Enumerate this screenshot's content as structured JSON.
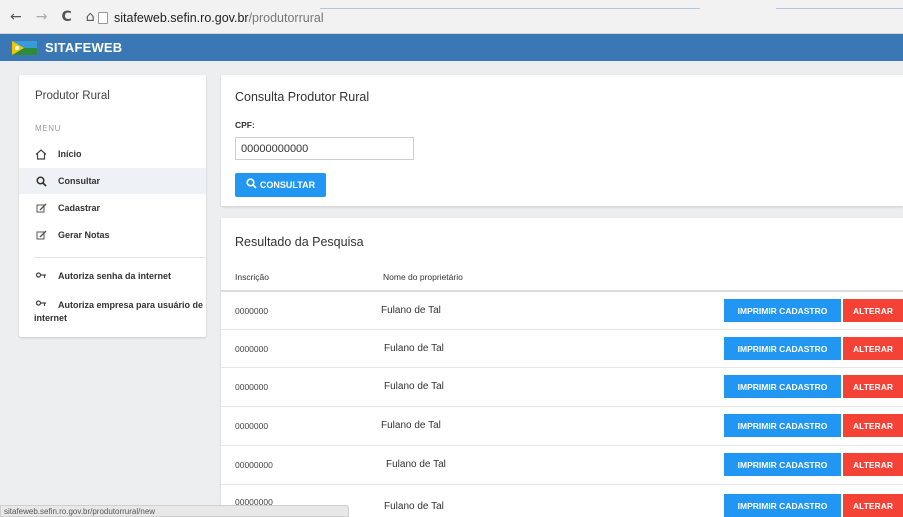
{
  "browser": {
    "url_host": "sitafeweb.sefin.ro.gov.br",
    "url_path": "/produtorrural",
    "status_url": "sitafeweb.sefin.ro.gov.br/produtorrural/new"
  },
  "app": {
    "title": "SITAFEWEB",
    "header_color": "#3a78b5"
  },
  "sidebar": {
    "title": "Produtor Rural",
    "menu_label": "MENU",
    "items": [
      {
        "label": "Início",
        "icon": "home-icon"
      },
      {
        "label": "Consultar",
        "icon": "search-icon",
        "active": true
      },
      {
        "label": "Cadastrar",
        "icon": "edit-icon"
      },
      {
        "label": "Gerar Notas",
        "icon": "edit-icon"
      },
      {
        "label": "Autoriza senha da internet",
        "icon": "key-icon"
      },
      {
        "label": "Autoriza empresa para usuário de internet",
        "icon": "key-icon"
      }
    ]
  },
  "consulta": {
    "title": "Consulta Produtor Rural",
    "cpf_label": "CPF:",
    "cpf_value": "00000000000",
    "button_label": "CONSULTAR"
  },
  "resultado": {
    "title": "Resultado da Pesquisa",
    "col_inscricao": "Inscrição",
    "col_nome": "Nome do proprietário",
    "print_label": "IMPRIMIR CADASTRO",
    "alter_label": "ALTERAR",
    "rows": [
      {
        "inscricao": "0000000",
        "nome": "Fulano de Tal"
      },
      {
        "inscricao": "0000000",
        "nome": "Fulano de Tal"
      },
      {
        "inscricao": "0000000",
        "nome": "Fulano de Tal"
      },
      {
        "inscricao": "0000000",
        "nome": "Fulano de Tal"
      },
      {
        "inscricao": "00000000",
        "nome": "Fulano de Tal"
      },
      {
        "inscricao": "00000000",
        "nome": "Fulano de Tal"
      }
    ]
  },
  "colors": {
    "primary_button": "#2196f3",
    "danger_button": "#f44336"
  }
}
